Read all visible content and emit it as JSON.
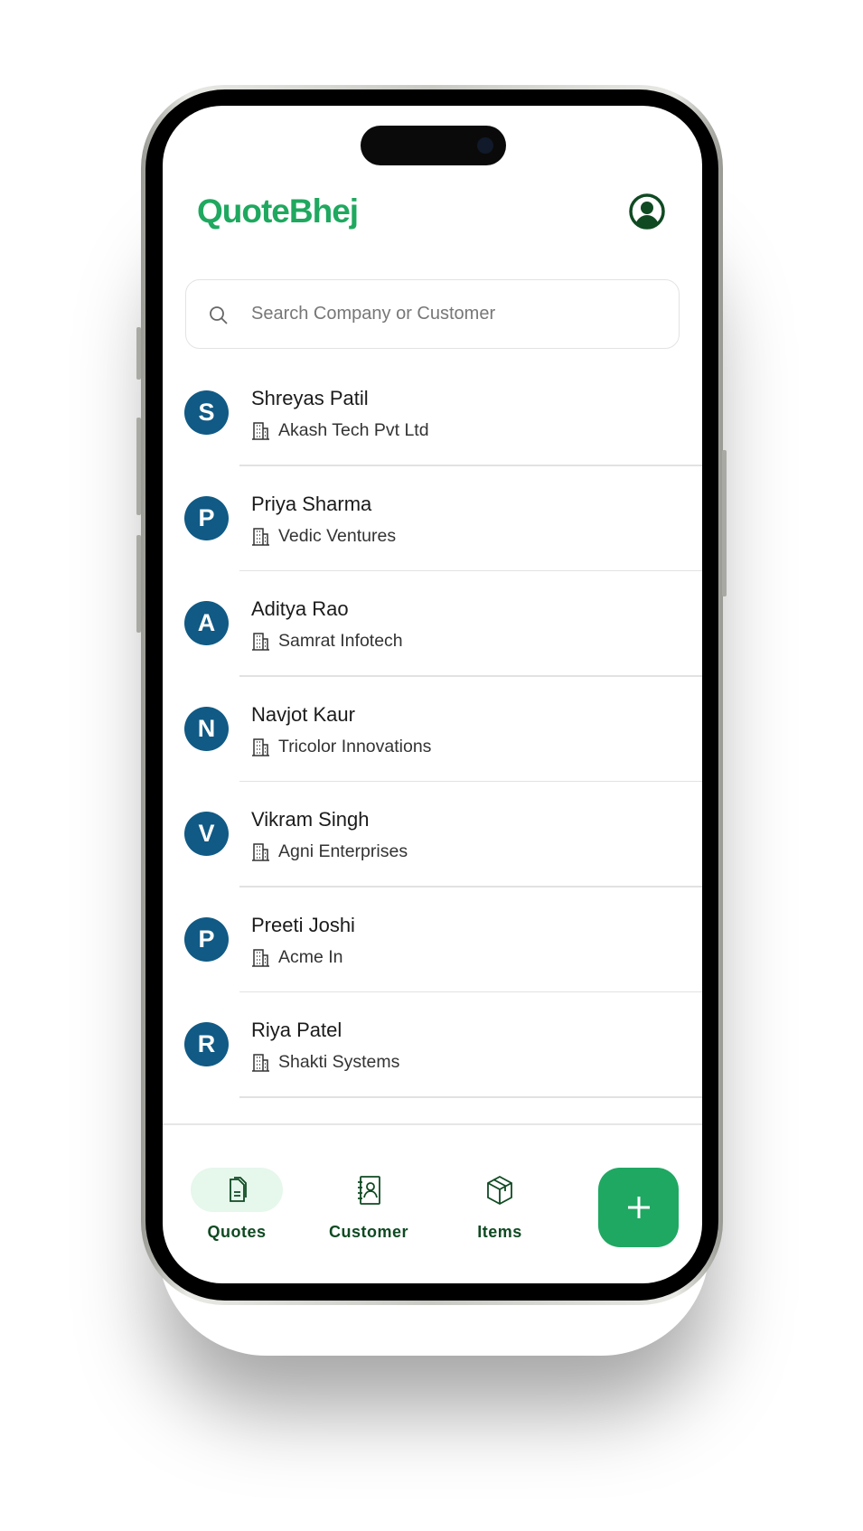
{
  "app": {
    "title": "QuoteBhej",
    "brand_color": "#1fa85f",
    "accent_dark": "#0f4a22",
    "avatar_color": "#105a85"
  },
  "header": {
    "profile_icon": "account-circle-icon"
  },
  "search": {
    "placeholder": "Search Company or Customer",
    "value": ""
  },
  "customers": [
    {
      "initial": "S",
      "name": "Shreyas Patil",
      "company": "Akash Tech Pvt Ltd"
    },
    {
      "initial": "P",
      "name": "Priya Sharma",
      "company": "Vedic Ventures"
    },
    {
      "initial": "A",
      "name": "Aditya Rao",
      "company": "Samrat Infotech"
    },
    {
      "initial": "N",
      "name": "Navjot Kaur",
      "company": "Tricolor Innovations"
    },
    {
      "initial": "V",
      "name": "Vikram Singh",
      "company": "Agni Enterprises"
    },
    {
      "initial": "P",
      "name": "Preeti Joshi",
      "company": "Acme In"
    },
    {
      "initial": "R",
      "name": "Riya Patel",
      "company": "Shakti Systems"
    }
  ],
  "nav": {
    "items": [
      {
        "label": "Quotes",
        "icon": "documents-icon",
        "active": true
      },
      {
        "label": "Customer",
        "icon": "contact-book-icon",
        "active": false
      },
      {
        "label": "Items",
        "icon": "package-icon",
        "active": false
      }
    ],
    "fab_icon": "plus-icon"
  }
}
